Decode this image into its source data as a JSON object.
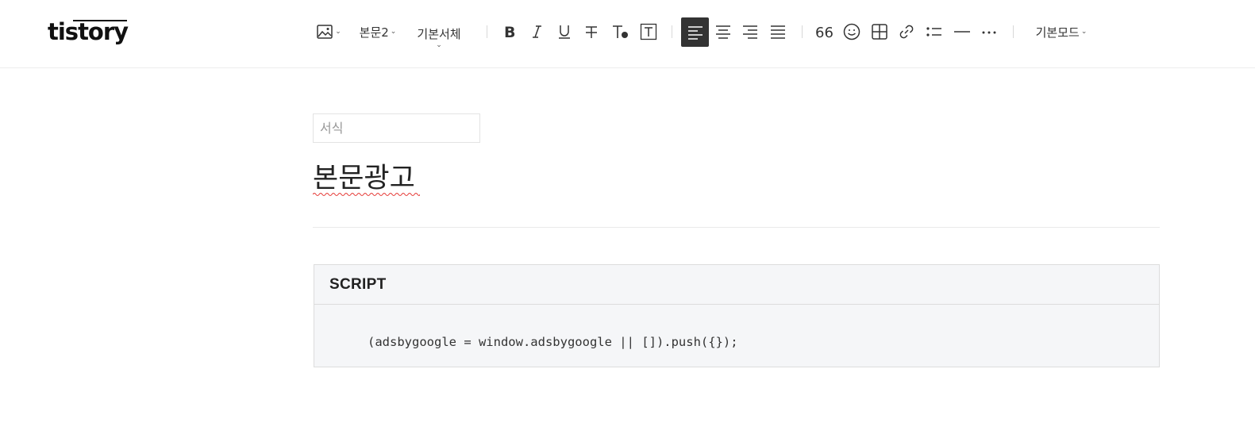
{
  "app": {
    "logo": "tistory"
  },
  "toolbar": {
    "paragraph_style": "본문2",
    "font": "기본서체",
    "mode": "기본모드"
  },
  "editor": {
    "format_placeholder": "서식",
    "title": "본문광고",
    "code_block": {
      "language": "SCRIPT",
      "code": "(adsbygoogle = window.adsbygoogle || []).push({});"
    }
  },
  "icons": [
    "image-icon",
    "bold-icon",
    "italic-icon",
    "underline-icon",
    "strikethrough-icon",
    "text-color-icon",
    "text-background-icon",
    "align-left-icon",
    "align-center-icon",
    "align-right-icon",
    "align-justify-icon",
    "quote-icon",
    "emoji-icon",
    "table-icon",
    "link-icon",
    "list-icon",
    "horizontal-rule-icon",
    "more-icon"
  ],
  "colors": {
    "active_button": "#333333",
    "code_bg": "#f5f6f8"
  }
}
